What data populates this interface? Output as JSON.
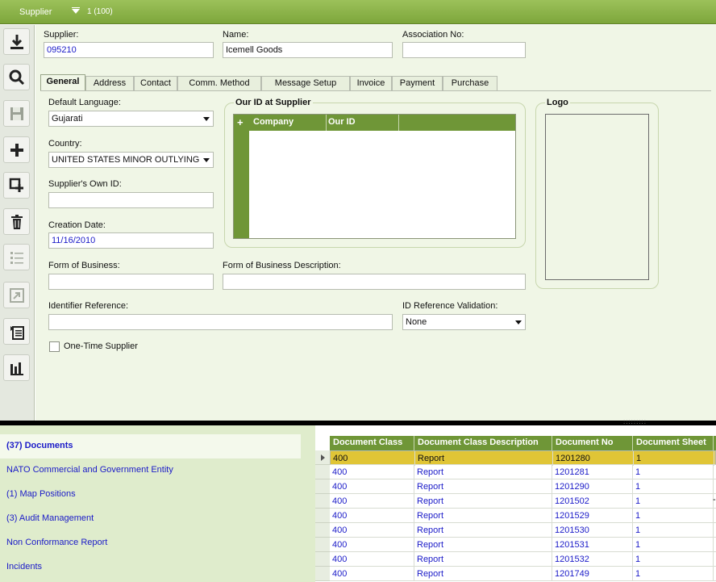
{
  "title": {
    "entity": "Supplier",
    "record_nav": "1 (100)"
  },
  "toolbar": {
    "buttons": [
      "save-icon",
      "search-icon",
      "disk-icon",
      "add-icon",
      "duplicate-icon",
      "delete-icon",
      "list-icon",
      "resize-icon",
      "document-list-icon",
      "bar-chart-icon"
    ]
  },
  "header": {
    "supplier_label": "Supplier:",
    "supplier_value": "095210",
    "name_label": "Name:",
    "name_value": "Icemell Goods",
    "association_label": "Association No:",
    "association_value": ""
  },
  "tabs": [
    "General",
    "Address",
    "Contact",
    "Comm. Method",
    "Message Setup",
    "Invoice",
    "Payment",
    "Purchase"
  ],
  "general": {
    "default_language_label": "Default Language:",
    "default_language_value": "Gujarati",
    "country_label": "Country:",
    "country_value": "UNITED STATES MINOR OUTLYING",
    "own_id_label": "Supplier's Own ID:",
    "own_id_value": "",
    "creation_date_label": "Creation Date:",
    "creation_date_value": "11/16/2010",
    "form_of_business_label": "Form of Business:",
    "form_of_business_value": "",
    "form_of_business_desc_label": "Form of Business Description:",
    "form_of_business_desc_value": "",
    "identifier_ref_label": "Identifier Reference:",
    "identifier_ref_value": "",
    "id_ref_validation_label": "ID Reference Validation:",
    "id_ref_validation_value": "None",
    "one_time_supplier_label": "One-Time Supplier",
    "our_id_group_title": "Our ID at Supplier",
    "our_id_columns": [
      "Company",
      "Our ID"
    ],
    "logo_group_title": "Logo"
  },
  "nav": {
    "items": [
      "(37) Documents",
      "NATO Commercial and Government Entity",
      "(1) Map Positions",
      "(3) Audit Management",
      "Non Conformance Report",
      "Incidents"
    ]
  },
  "documents": {
    "columns": [
      "Document Class",
      "Document Class Description",
      "Document No",
      "Document Sheet"
    ],
    "rows": [
      [
        "400",
        "Report",
        "1201280",
        "1"
      ],
      [
        "400",
        "Report",
        "1201281",
        "1"
      ],
      [
        "400",
        "Report",
        "1201290",
        "1"
      ],
      [
        "400",
        "Report",
        "1201502",
        "1"
      ],
      [
        "400",
        "Report",
        "1201529",
        "1"
      ],
      [
        "400",
        "Report",
        "1201530",
        "1"
      ],
      [
        "400",
        "Report",
        "1201531",
        "1"
      ],
      [
        "400",
        "Report",
        "1201532",
        "1"
      ],
      [
        "400",
        "Report",
        "1201749",
        "1"
      ]
    ],
    "trailing_glyph": "-"
  },
  "colors": {
    "accent": "#7da63b",
    "selected_row": "#e0c536",
    "link": "#1a1ac8"
  }
}
